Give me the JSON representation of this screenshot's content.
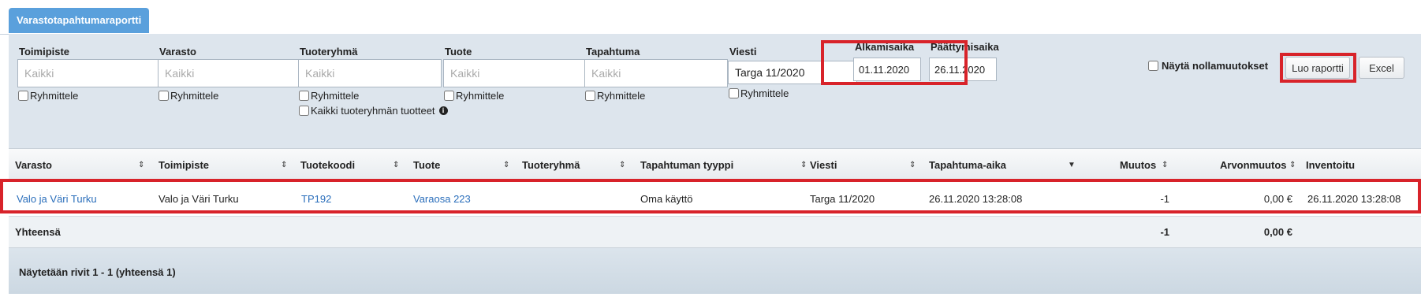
{
  "tab": {
    "label": "Varastotapahtumaraportti"
  },
  "filters": {
    "toimipiste": {
      "label": "Toimipiste",
      "placeholder": "Kaikki",
      "value": "",
      "group_label": "Ryhmittele"
    },
    "varasto": {
      "label": "Varasto",
      "placeholder": "Kaikki",
      "value": "",
      "group_label": "Ryhmittele"
    },
    "tuoteryhma": {
      "label": "Tuoteryhmä",
      "placeholder": "Kaikki",
      "value": "",
      "group_label": "Ryhmittele",
      "all_products_label": "Kaikki tuoteryhmän tuotteet"
    },
    "tuote": {
      "label": "Tuote",
      "placeholder": "Kaikki",
      "value": "",
      "group_label": "Ryhmittele"
    },
    "tapahtuma": {
      "label": "Tapahtuma",
      "placeholder": "Kaikki",
      "value": "",
      "group_label": "Ryhmittele"
    },
    "viesti": {
      "label": "Viesti",
      "value": "Targa 11/2020",
      "group_label": "Ryhmittele"
    },
    "alkamisaika": {
      "label": "Alkamisaika",
      "value": "01.11.2020"
    },
    "paattymisaika": {
      "label": "Päättymisaika",
      "value": "26.11.2020"
    },
    "nayta_nollamuutokset": {
      "label": "Näytä nollamuutokset"
    },
    "luo_raportti": "Luo raportti",
    "excel": "Excel"
  },
  "table": {
    "headers": [
      "Varasto",
      "Toimipiste",
      "Tuotekoodi",
      "Tuote",
      "Tuoteryhmä",
      "Tapahtuman tyyppi",
      "Viesti",
      "Tapahtuma-aika",
      "Muutos",
      "Arvonmuutos",
      "Inventoitu"
    ],
    "row": {
      "varasto": "Valo ja Väri Turku",
      "toimipiste": "Valo ja Väri Turku",
      "tuotekoodi": "TP192",
      "tuote": "Varaosa 223",
      "tuoteryhma": "",
      "tapahtuman_tyyppi": "Oma käyttö",
      "viesti": "Targa 11/2020",
      "tapahtuma_aika": "26.11.2020 13:28:08",
      "muutos": "-1",
      "arvonmuutos": "0,00 €",
      "inventoitu": "26.11.2020 13:28:08"
    },
    "totals": {
      "label": "Yhteensä",
      "muutos": "-1",
      "arvonmuutos": "0,00 €"
    }
  },
  "pager": {
    "text": "Näytetään rivit 1 - 1 (yhteensä 1)"
  },
  "colors": {
    "tab": "#5aa0dc",
    "filter_bg": "#dde5ed",
    "highlight": "#d8232a",
    "link": "#2a6ebb"
  }
}
